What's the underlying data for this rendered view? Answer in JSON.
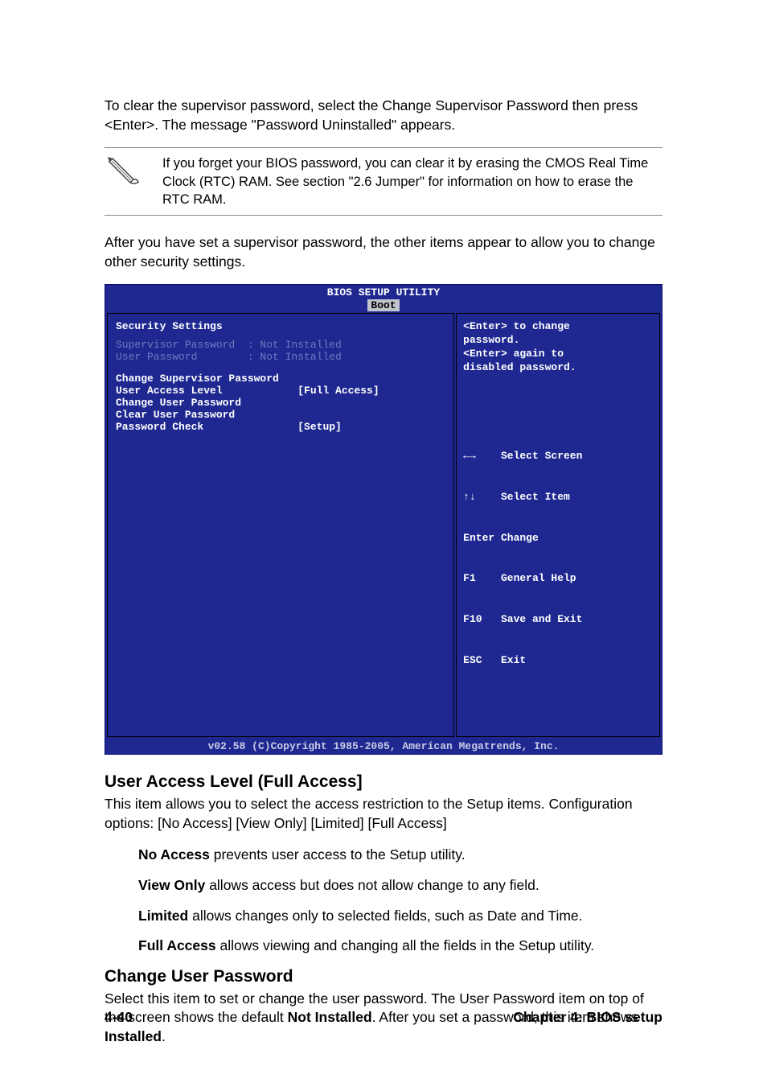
{
  "intro1": "To clear the supervisor password, select the Change Supervisor Password then press <Enter>. The message \"Password Uninstalled\" appears.",
  "note": "If you forget your BIOS password, you can clear it by erasing the CMOS Real Time Clock (RTC) RAM. See section \"2.6  Jumper\" for information on how to erase the RTC RAM.",
  "intro2": "After you have set a supervisor password, the other items appear to allow you to change other security settings.",
  "bios": {
    "title": "BIOS SETUP UTILITY",
    "tab": "Boot",
    "heading": "Security Settings",
    "rows_dim": [
      "Supervisor Password  : Not Installed",
      "User Password        : Not Installed"
    ],
    "rows_main": [
      "Change Supervisor Password",
      "User Access Level            [Full Access]",
      "Change User Password",
      "Clear User Password",
      "Password Check               [Setup]"
    ],
    "help": [
      "<Enter> to change",
      "password.",
      "<Enter> again to",
      "disabled password."
    ],
    "keys": [
      "←→    Select Screen",
      "↑↓    Select Item",
      "Enter Change",
      "F1    General Help",
      "F10   Save and Exit",
      "ESC   Exit"
    ],
    "footer": "v02.58 (C)Copyright 1985-2005, American Megatrends, Inc."
  },
  "sec1": {
    "title": "User Access Level (Full Access]",
    "body": "This item allows you to select the access restriction to the Setup items. Configuration options: [No Access] [View Only] [Limited] [Full Access]",
    "opts": [
      {
        "bold": "No Access",
        "rest": " prevents user access to the Setup utility."
      },
      {
        "bold": "View Only",
        "rest": " allows access but does not allow change to any field."
      },
      {
        "bold": "Limited",
        "rest": " allows changes only to selected fields, such as Date and Time."
      },
      {
        "bold": "Full Access",
        "rest": " allows viewing and changing all the fields in the Setup utility."
      }
    ]
  },
  "sec2": {
    "title": "Change User Password",
    "body_pre": "Select this item to set or change the user password. The User Password item on top of the screen shows the default ",
    "body_bold1": "Not Installed",
    "body_mid": ". After you set a password, this item shows ",
    "body_bold2": "Installed",
    "body_post": "."
  },
  "footer": {
    "left": "4-40",
    "right": "Chapter 4: BIOS setup"
  }
}
